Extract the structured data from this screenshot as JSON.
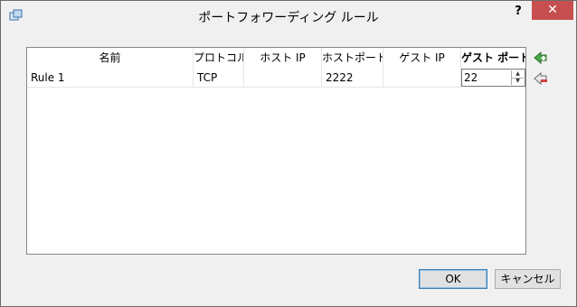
{
  "window": {
    "title": "ポートフォワーディング ルール",
    "help": "?",
    "close": "✕"
  },
  "grid": {
    "columns": [
      "名前",
      "プロトコル",
      "ホスト IP",
      "ホストポート",
      "ゲスト IP",
      "ゲスト ポート"
    ],
    "active_column": "ゲスト ポート",
    "rows": [
      {
        "name": "Rule 1",
        "protocol": "TCP",
        "host_ip": "",
        "host_port": "2222",
        "guest_ip": "",
        "guest_port": "22"
      }
    ]
  },
  "side_buttons": {
    "add": "add-rule-icon",
    "remove": "remove-rule-icon"
  },
  "buttons": {
    "ok": "OK",
    "cancel": "キャンセル"
  },
  "colors": {
    "close_bg": "#c74f4f",
    "add_icon": "#4aa84a",
    "remove_icon": "#d04040"
  }
}
